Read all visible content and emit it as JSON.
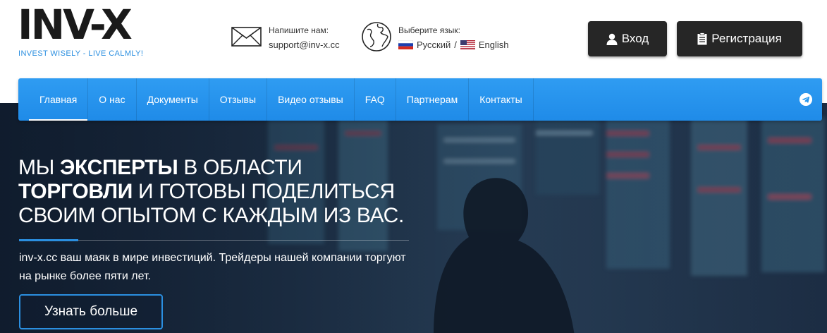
{
  "header": {
    "logo_text": "INV-X",
    "tagline": "INVEST WISELY - LIVE CALMLY!",
    "contact_label": "Напишите нам:",
    "contact_email": "support@inv-x.cc",
    "lang_label": "Выберите язык:",
    "lang_ru": "Русский",
    "lang_sep": "/",
    "lang_en": "English",
    "login_label": "Вход",
    "register_label": "Регистрация"
  },
  "nav": {
    "items": [
      "Главная",
      "О нас",
      "Документы",
      "Отзывы",
      "Видео отзывы",
      "FAQ",
      "Партнерам",
      "Контакты"
    ],
    "active_index": 0
  },
  "hero": {
    "title_1": "МЫ ",
    "title_2": "ЭКСПЕРТЫ",
    "title_3": " В ОБЛАСТИ ",
    "title_4": "ТОРГОВЛИ",
    "title_5": " И ГОТОВЫ ПОДЕЛИТЬСЯ СВОИМ ОПЫТОМ С КАЖДЫМ ИЗ ВАС.",
    "description": "inv-x.cc ваш маяк в мире инвестиций. Трейдеры нашей компании торгуют на рынке более пяти лет.",
    "button_label": "Узнать больше"
  },
  "colors": {
    "accent": "#2b8fe0",
    "nav_bg": "#2596ee",
    "dark_button": "#262626"
  },
  "icons": [
    "mail-icon",
    "globe-icon",
    "flag-ru-icon",
    "flag-us-icon",
    "user-icon",
    "clipboard-icon",
    "telegram-icon"
  ]
}
